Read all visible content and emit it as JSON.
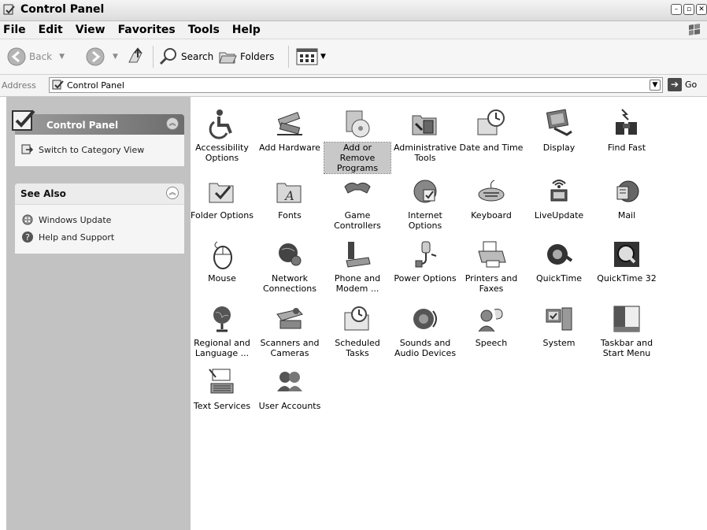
{
  "window": {
    "title": "Control Panel",
    "controls": [
      "minimize",
      "maximize",
      "close"
    ]
  },
  "menu": [
    "File",
    "Edit",
    "View",
    "Favorites",
    "Tools",
    "Help"
  ],
  "toolbar": {
    "back": "Back",
    "search": "Search",
    "folders": "Folders"
  },
  "address": {
    "label": "Address",
    "value": "Control Panel",
    "go": "Go"
  },
  "sidebar": {
    "control_panel": {
      "title": "Control Panel",
      "switch_link": "Switch to Category View"
    },
    "see_also": {
      "title": "See Also",
      "links": [
        "Windows Update",
        "Help and Support"
      ]
    }
  },
  "items": [
    {
      "label": "Accessibility Options",
      "icon": "accessibility-icon"
    },
    {
      "label": "Add Hardware",
      "icon": "add-hardware-icon"
    },
    {
      "label": "Add or Remove Programs",
      "icon": "add-remove-programs-icon",
      "selected": true
    },
    {
      "label": "Administrative Tools",
      "icon": "administrative-tools-icon"
    },
    {
      "label": "Date and Time",
      "icon": "date-time-icon"
    },
    {
      "label": "Display",
      "icon": "display-icon"
    },
    {
      "label": "Find Fast",
      "icon": "find-fast-icon"
    },
    {
      "label": "Folder Options",
      "icon": "folder-options-icon"
    },
    {
      "label": "Fonts",
      "icon": "fonts-icon"
    },
    {
      "label": "Game Controllers",
      "icon": "game-controllers-icon"
    },
    {
      "label": "Internet Options",
      "icon": "internet-options-icon"
    },
    {
      "label": "Keyboard",
      "icon": "keyboard-icon"
    },
    {
      "label": "LiveUpdate",
      "icon": "liveupdate-icon"
    },
    {
      "label": "Mail",
      "icon": "mail-icon"
    },
    {
      "label": "Mouse",
      "icon": "mouse-icon"
    },
    {
      "label": "Network Connections",
      "icon": "network-connections-icon"
    },
    {
      "label": "Phone and Modem ...",
      "icon": "phone-modem-icon"
    },
    {
      "label": "Power Options",
      "icon": "power-options-icon"
    },
    {
      "label": "Printers and Faxes",
      "icon": "printers-faxes-icon"
    },
    {
      "label": "QuickTime",
      "icon": "quicktime-icon"
    },
    {
      "label": "QuickTime 32",
      "icon": "quicktime-32-icon"
    },
    {
      "label": "Regional and Language ...",
      "icon": "regional-language-icon"
    },
    {
      "label": "Scanners and Cameras",
      "icon": "scanners-cameras-icon"
    },
    {
      "label": "Scheduled Tasks",
      "icon": "scheduled-tasks-icon"
    },
    {
      "label": "Sounds and Audio Devices",
      "icon": "sounds-audio-icon"
    },
    {
      "label": "Speech",
      "icon": "speech-icon"
    },
    {
      "label": "System",
      "icon": "system-icon"
    },
    {
      "label": "Taskbar and Start Menu",
      "icon": "taskbar-start-menu-icon"
    },
    {
      "label": "Text Services",
      "icon": "text-services-icon"
    },
    {
      "label": "User Accounts",
      "icon": "user-accounts-icon"
    }
  ]
}
